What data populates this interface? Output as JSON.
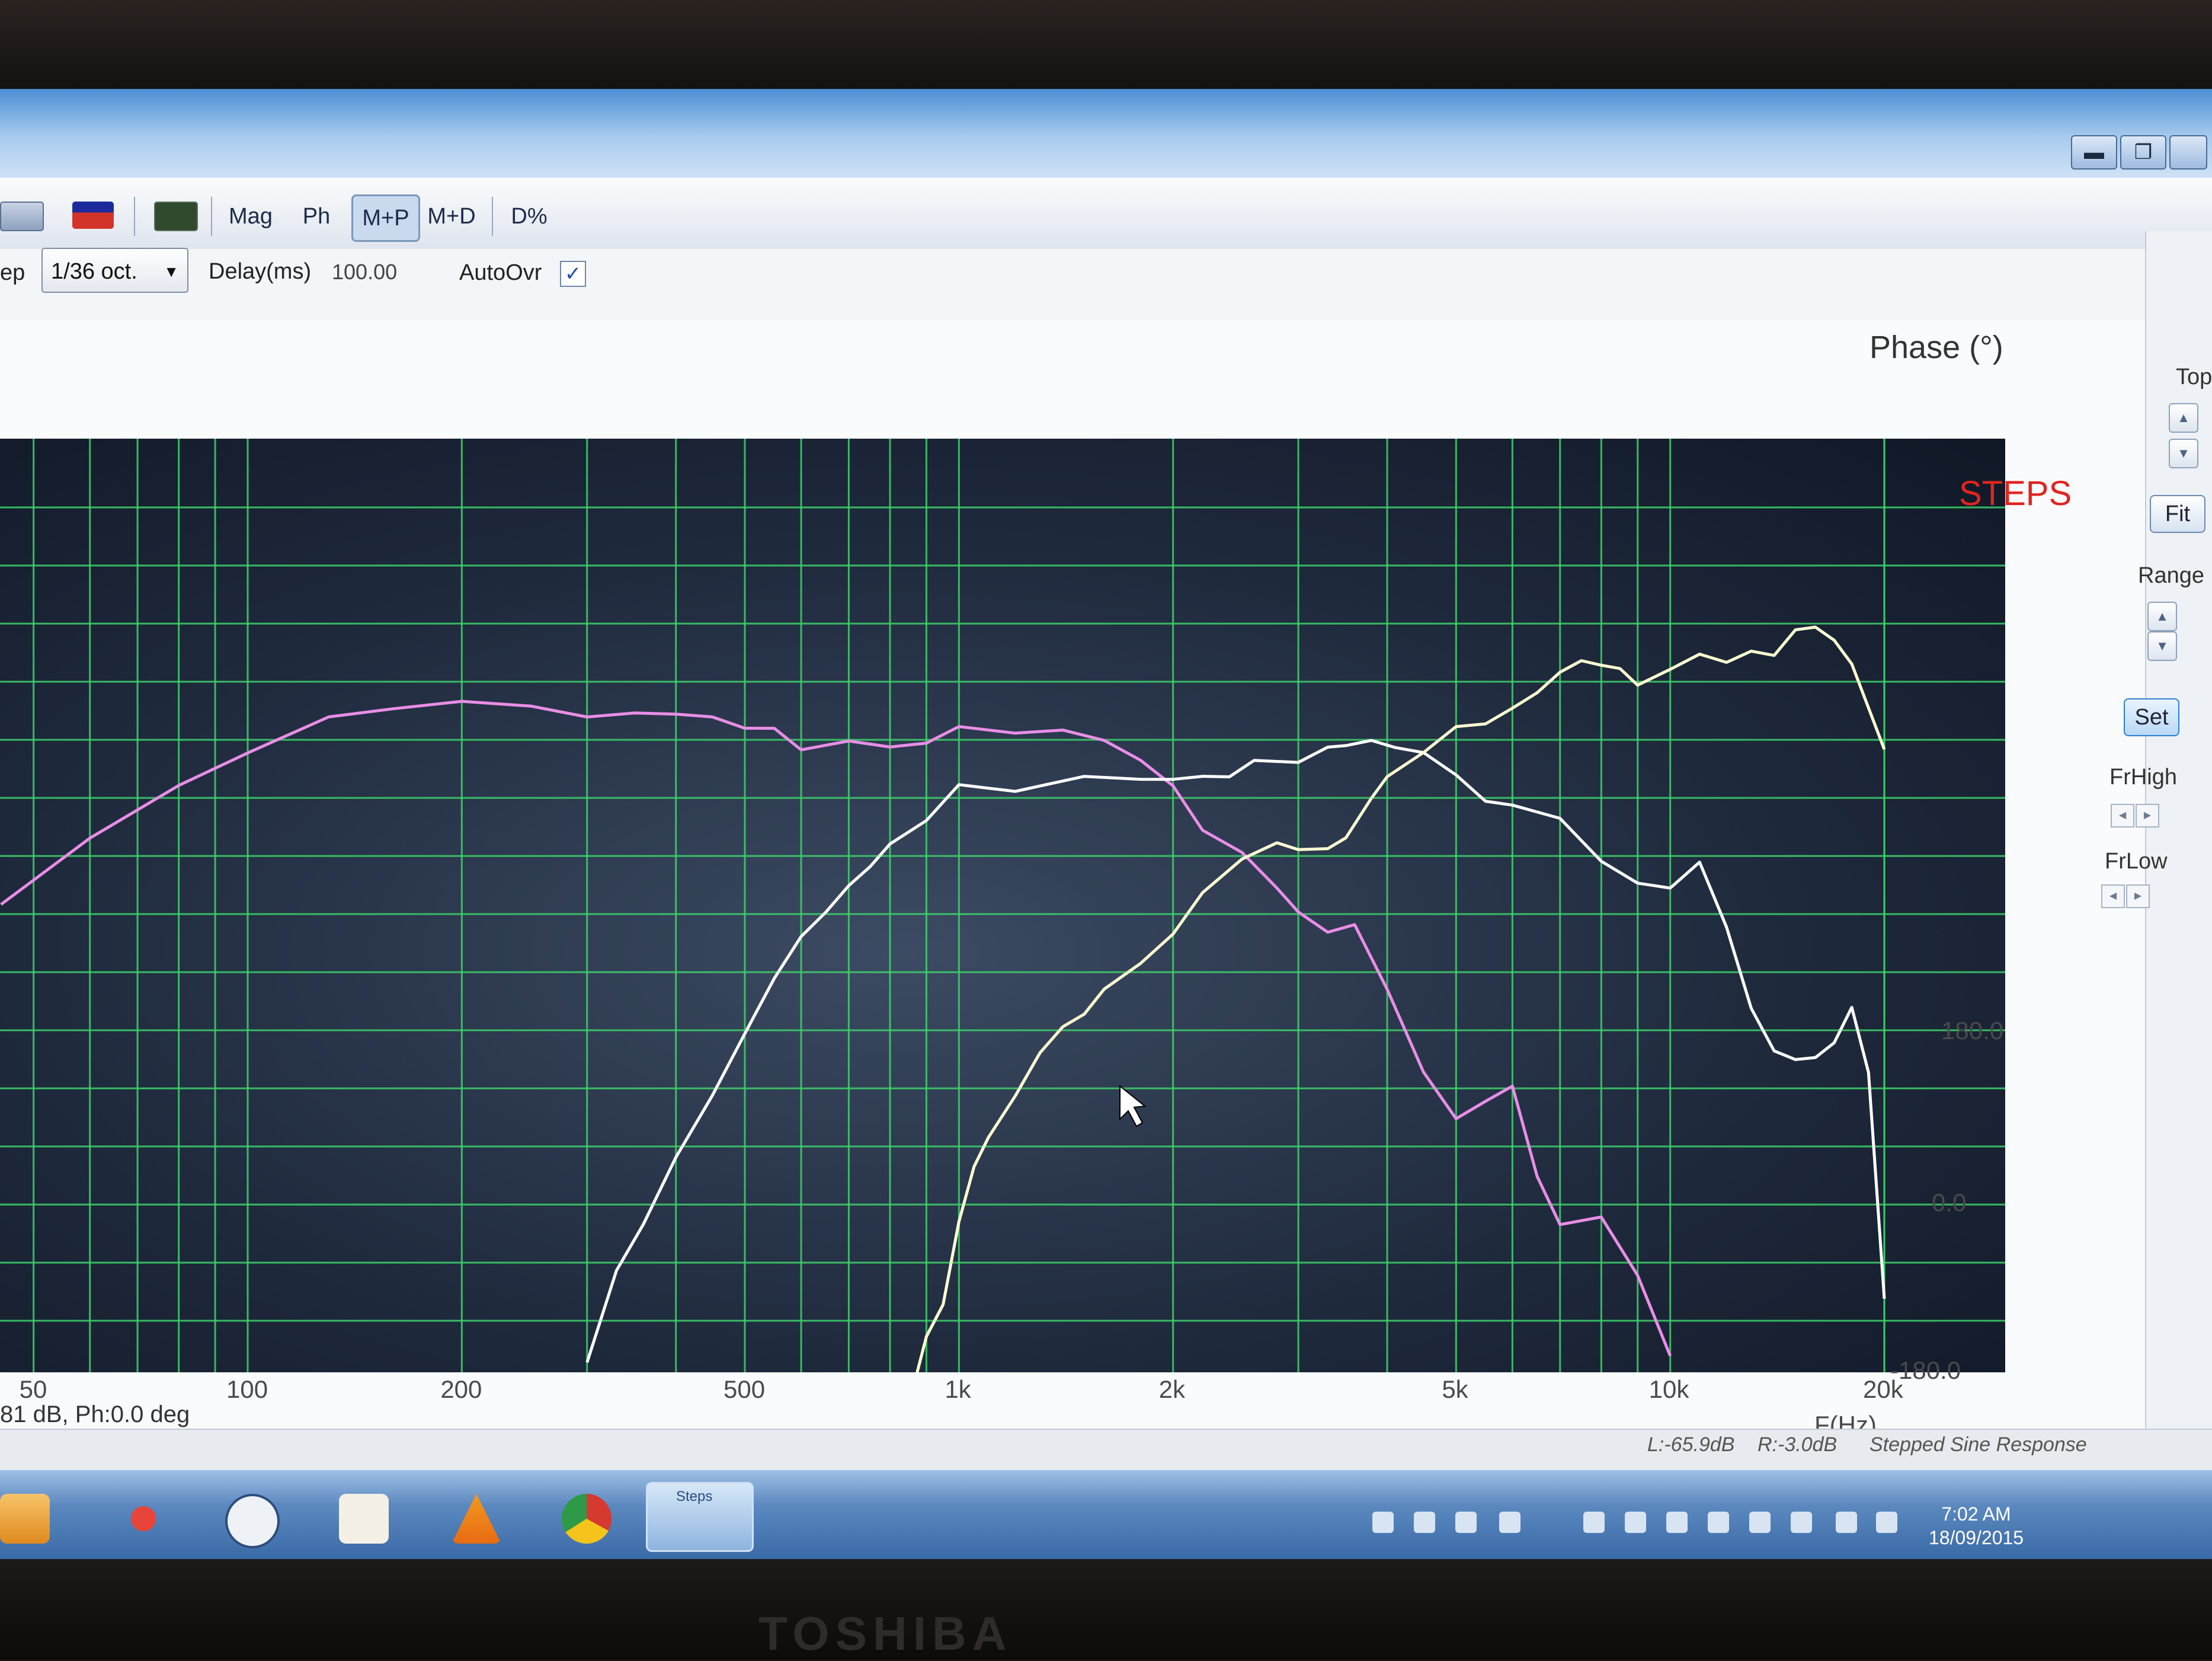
{
  "window": {
    "title": "",
    "buttons": {
      "minimize": "▬",
      "restore": "❐"
    }
  },
  "toolbar": {
    "mag_label": "Mag",
    "ph_label": "Ph",
    "mp_label": "M+P",
    "md_label": "M+D",
    "dpct_label": "D%"
  },
  "options": {
    "step_label": "ep",
    "step_value": "1/36 oct.",
    "delay_label": "Delay(ms)",
    "delay_value": "100.00",
    "autoovr_label": "AutoOvr",
    "autoovr_checked": "✓"
  },
  "side_panel": {
    "top_label": "Top",
    "fit_label": "Fit",
    "range_label": "Range",
    "set_label": "Set",
    "frhigh_label": "FrHigh",
    "frlow_label": "FrLow"
  },
  "readout": "81 dB, Ph:0.0 deg",
  "status": {
    "left": "L:-65.9dB",
    "right": "R:-3.0dB",
    "mode": "Stepped Sine Response"
  },
  "taskbar": {
    "steps_label": "Steps",
    "time": "7:02 AM",
    "date": "18/09/2015"
  },
  "bezel_brand": "TOSHIBA",
  "chart_data": {
    "type": "line",
    "watermark": "STEPS",
    "ylabel": "Phase (°)",
    "xlabel": "F(Hz)",
    "x_scale": "log",
    "xlim": [
      20,
      20000
    ],
    "ylim_right_axis": [
      -180,
      180
    ],
    "ytick_labels": [
      "180.0",
      "0.0",
      "-180.0"
    ],
    "xtick_labels": [
      "50",
      "100",
      "200",
      "500",
      "1k",
      "2k",
      "5k",
      "10k",
      "20k"
    ],
    "xtick_values": [
      50,
      100,
      200,
      500,
      1000,
      2000,
      5000,
      10000,
      20000
    ],
    "grid": true,
    "series": [
      {
        "color": "#e88ee6",
        "x": [
          45,
          60,
          80,
          100,
          130,
          160,
          200,
          250,
          300,
          350,
          400,
          450,
          500,
          550,
          600,
          700,
          800,
          900,
          1000,
          1200,
          1400,
          1600,
          1800,
          2000,
          2200,
          2500,
          2800,
          3000,
          3300,
          3600,
          4000,
          4500,
          5000,
          5500,
          6000,
          6500,
          7000,
          8000,
          9000,
          10000
        ],
        "y": [
          310,
          380,
          430,
          470,
          500,
          515,
          518,
          515,
          505,
          505,
          510,
          500,
          495,
          490,
          470,
          480,
          470,
          480,
          490,
          490,
          488,
          480,
          460,
          430,
          390,
          360,
          330,
          300,
          282,
          290,
          220,
          140,
          85,
          110,
          120,
          30,
          -20,
          -15,
          -70,
          -160
        ]
      },
      {
        "color": "#ffffff",
        "x": [
          300,
          330,
          360,
          400,
          450,
          500,
          550,
          600,
          650,
          700,
          750,
          800,
          900,
          1000,
          1200,
          1500,
          1800,
          2000,
          2200,
          2400,
          2600,
          3000,
          3300,
          3500,
          3800,
          4100,
          4500,
          5000,
          5500,
          6000,
          7000,
          8000,
          9000,
          10000,
          11000,
          12000,
          13000,
          14000,
          15000,
          16000,
          17000,
          18000,
          19000,
          20000
        ],
        "y": [
          -160,
          -70,
          -20,
          50,
          110,
          180,
          230,
          280,
          300,
          330,
          350,
          370,
          400,
          430,
          430,
          440,
          440,
          440,
          440,
          445,
          455,
          460,
          470,
          475,
          480,
          470,
          470,
          440,
          420,
          410,
          400,
          355,
          330,
          330,
          350,
          290,
          200,
          160,
          150,
          150,
          170,
          200,
          140,
          -100
        ]
      },
      {
        "color": "#ffffd2",
        "x": [
          870,
          900,
          950,
          1000,
          1050,
          1100,
          1200,
          1300,
          1400,
          1500,
          1600,
          1800,
          2000,
          2200,
          2500,
          2800,
          3000,
          3300,
          3500,
          3800,
          4000,
          4500,
          5000,
          5500,
          6000,
          6500,
          7000,
          7500,
          8000,
          8500,
          9000,
          10000,
          11000,
          12000,
          13000,
          14000,
          15000,
          16000,
          17000,
          18000,
          20000
        ],
        "y": [
          -175,
          -140,
          -100,
          -20,
          40,
          70,
          110,
          160,
          180,
          200,
          220,
          250,
          280,
          320,
          360,
          370,
          370,
          365,
          380,
          420,
          440,
          470,
          490,
          500,
          510,
          530,
          550,
          560,
          560,
          550,
          540,
          550,
          570,
          560,
          570,
          570,
          590,
          600,
          580,
          560,
          470
        ]
      }
    ]
  }
}
